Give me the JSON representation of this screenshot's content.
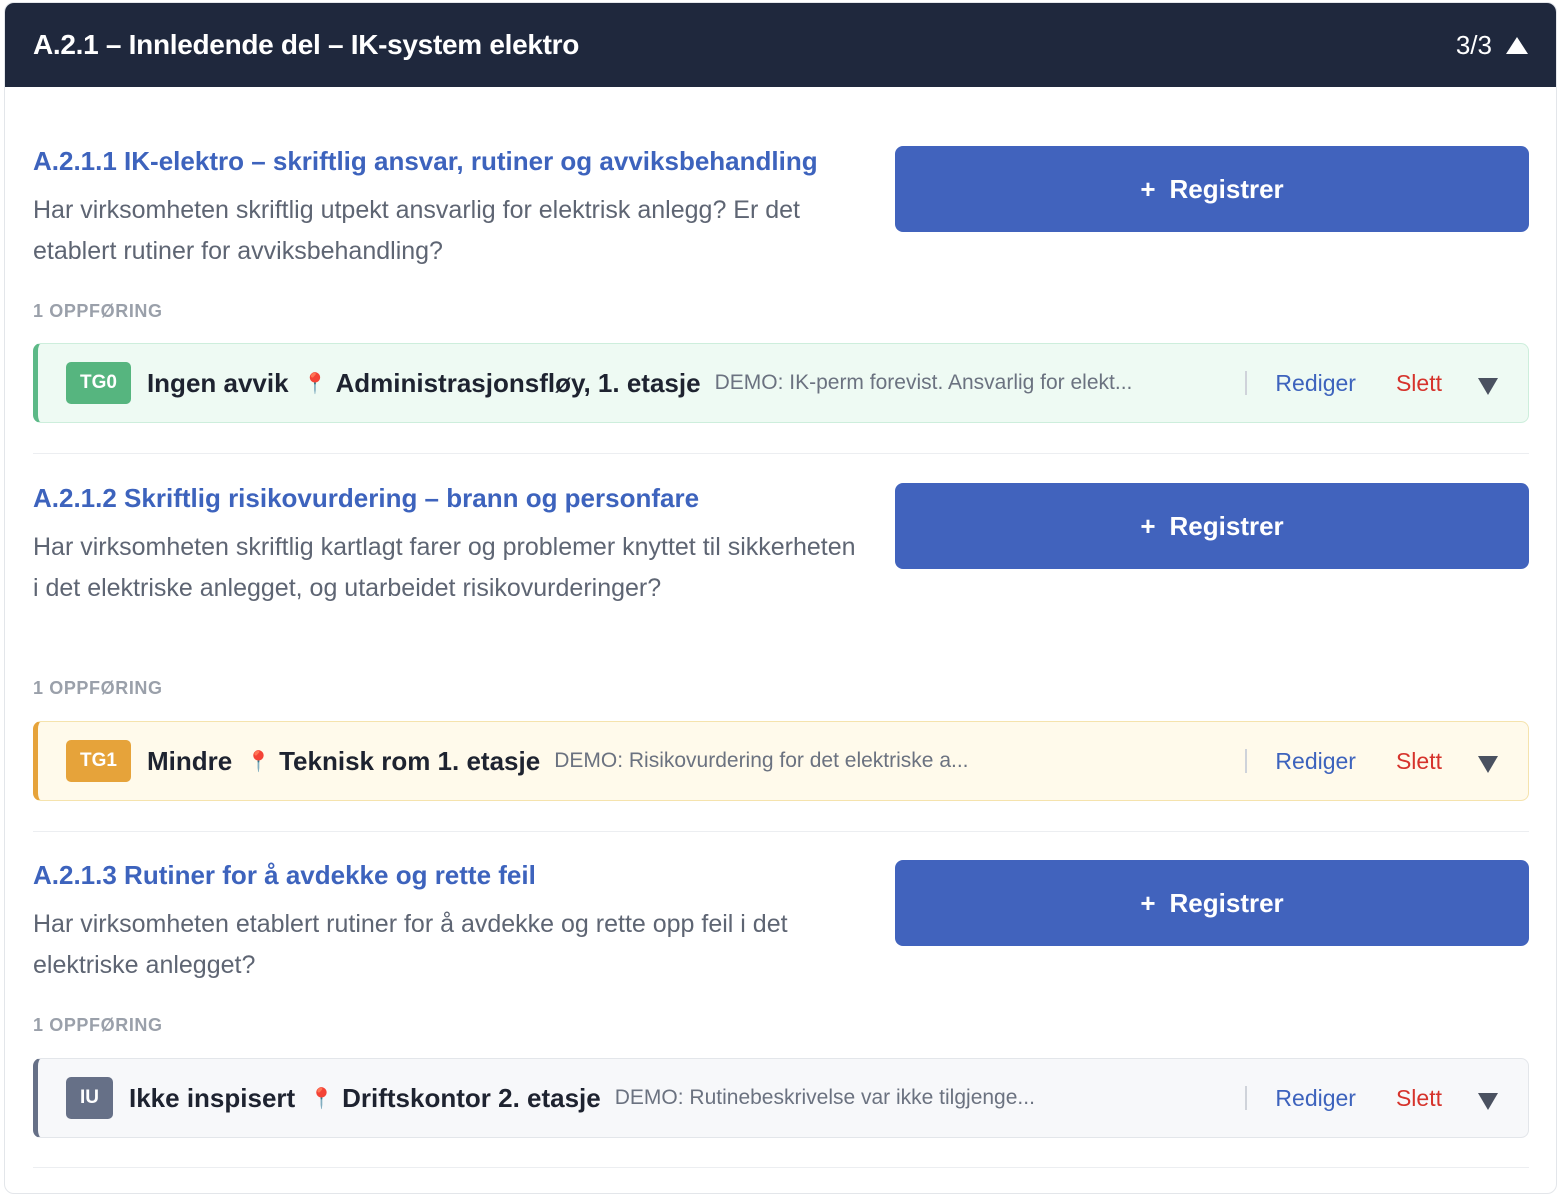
{
  "header": {
    "title": "A.2.1 – Innledende del – IK-system elektro",
    "count": "3/3",
    "collapse_icon": "caret-up-icon"
  },
  "questions": [
    {
      "title": "A.2.1.1 IK-elektro – skriftlig ansvar, rutiner og avviksbehandling",
      "text": "Har virksomheten skriftlig utpekt ansvarlig for elektrisk anlegg? Er det etablert rutiner for avviksbehandling?",
      "register_label": "Registrer",
      "register_icon": "+",
      "count_label": "1 OPPFØRING",
      "entry": {
        "badge": "TG0",
        "status": "Ingen avvik",
        "pin_icon": "📍",
        "location": "Administrasjonsfløy, 1. etasje",
        "note": "DEMO: IK-perm forevist. Ansvarlig for elekt...",
        "edit_label": "Rediger",
        "delete_label": "Slett",
        "color": "#56b57f"
      }
    },
    {
      "title": "A.2.1.2 Skriftlig risikovurdering – brann og personfare",
      "text": "Har virksomheten skriftlig kartlagt farer og problemer knyttet til sikkerheten i det elektriske anlegget, og utarbeidet risikovurderinger?",
      "register_label": "Registrer",
      "register_icon": "+",
      "count_label": "1 OPPFØRING",
      "entry": {
        "badge": "TG1",
        "status": "Mindre",
        "pin_icon": "📍",
        "location": "Teknisk rom 1. etasje",
        "note": "DEMO: Risikovurdering for det elektriske a...",
        "edit_label": "Rediger",
        "delete_label": "Slett",
        "color": "#e6a33a"
      }
    },
    {
      "title": "A.2.1.3 Rutiner for å avdekke og rette feil",
      "text": "Har virksomheten etablert rutiner for å avdekke og rette opp feil i det elektriske anlegget?",
      "register_label": "Registrer",
      "register_icon": "+",
      "count_label": "1 OPPFØRING",
      "entry": {
        "badge": "IU",
        "status": "Ikke inspisert",
        "pin_icon": "📍",
        "location": "Driftskontor 2. etasje",
        "note": "DEMO: Rutinebeskrivelse var ikke tilgjenge...",
        "edit_label": "Rediger",
        "delete_label": "Slett",
        "color": "#667087"
      }
    }
  ]
}
